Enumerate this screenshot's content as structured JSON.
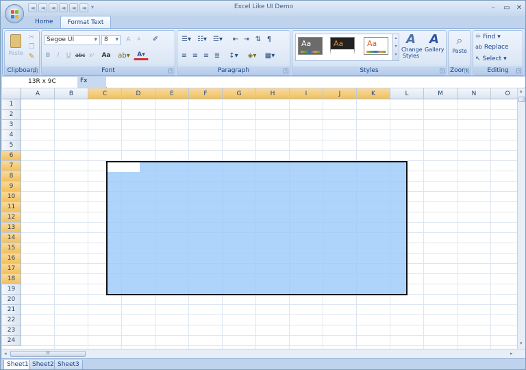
{
  "window": {
    "title": "Excel Like UI Demo",
    "minimize": "–",
    "maximize": "▭",
    "close": "✕"
  },
  "qat": {
    "items": [
      "◄",
      "◄",
      "◄",
      "◄",
      "◄",
      "◄",
      "▾"
    ]
  },
  "tabs": [
    {
      "label": "Home"
    },
    {
      "label": "Format Text",
      "active": true
    }
  ],
  "ribbon": {
    "clipboard": {
      "label": "Clipboard",
      "paste": "Paste"
    },
    "font": {
      "label": "Font",
      "family": "Segoe UI",
      "size": "8",
      "bold": "B",
      "italic": "I",
      "underline": "U",
      "strike": "abc",
      "sub": "x²",
      "case": "Aa",
      "grow": "A",
      "shrink": "A"
    },
    "paragraph": {
      "label": "Paragraph"
    },
    "styles": {
      "label": "Styles",
      "swatch_text": "Aa",
      "change_styles": "Change Styles",
      "gallery": "Gallery"
    },
    "zoom": {
      "label": "Zoom",
      "paste": "Paste"
    },
    "editing": {
      "label": "Editing",
      "find": "Find",
      "replace": "Replace",
      "select": "Select"
    }
  },
  "formula_bar": {
    "name_box": "13R x 9C",
    "fx": "Fx",
    "value": ""
  },
  "columns": [
    "A",
    "B",
    "C",
    "D",
    "E",
    "F",
    "G",
    "H",
    "I",
    "J",
    "K",
    "L",
    "M",
    "N",
    "O"
  ],
  "selected_columns": [
    "C",
    "D",
    "E",
    "F",
    "G",
    "H",
    "I",
    "J",
    "K"
  ],
  "rows": [
    "1",
    "2",
    "3",
    "4",
    "5",
    "6",
    "7",
    "8",
    "9",
    "10",
    "11",
    "12",
    "13",
    "14",
    "15",
    "16",
    "17",
    "18",
    "19",
    "20",
    "21",
    "22",
    "23",
    "24"
  ],
  "selected_rows": [
    "6",
    "7",
    "8",
    "9",
    "10",
    "11",
    "12",
    "13",
    "14",
    "15",
    "16",
    "17",
    "18"
  ],
  "scroll": {
    "hthumb": "III",
    "left": "◂",
    "right": "▸",
    "up": "▴",
    "down": "▾"
  },
  "sheets": [
    {
      "label": "Sheet1",
      "active": true
    },
    {
      "label": "Sheet2"
    },
    {
      "label": "Sheet3"
    }
  ],
  "colors": {
    "accent": "#15428b",
    "selection": "#99c8fa",
    "header_selected": "#f1c15f"
  }
}
